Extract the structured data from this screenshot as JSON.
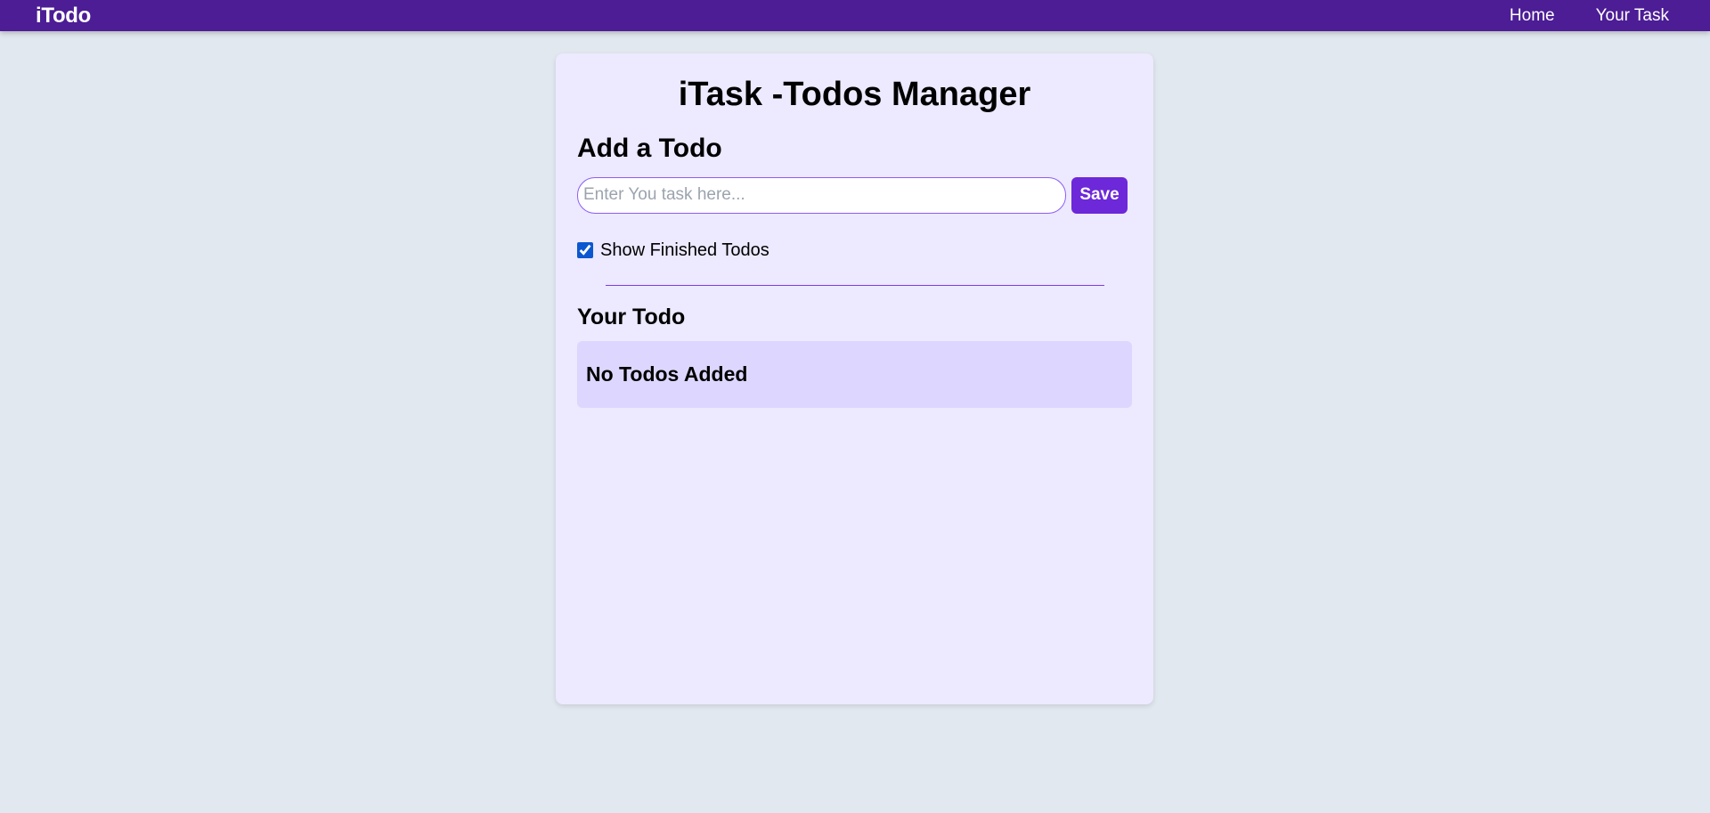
{
  "navbar": {
    "brand": "iTodo",
    "links": [
      {
        "label": "Home"
      },
      {
        "label": "Your Task"
      }
    ]
  },
  "main": {
    "title": "iTask -Todos Manager",
    "add_section": {
      "heading": "Add a Todo",
      "input_placeholder": "Enter You task here...",
      "input_value": "",
      "save_label": "Save"
    },
    "filter": {
      "label": "Show Finished Todos",
      "checked": true
    },
    "list_section": {
      "heading": "Your Todo",
      "empty_message": "No Todos Added"
    }
  },
  "colors": {
    "navbar_bg": "#4c1d95",
    "page_bg": "#e2e8f0",
    "card_bg": "#ede9fe",
    "accent": "#6d28d9",
    "empty_box_bg": "#ddd6fe"
  }
}
